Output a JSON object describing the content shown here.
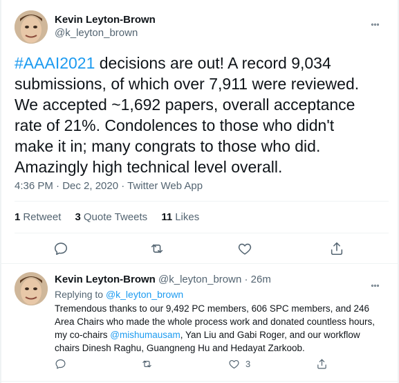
{
  "main_tweet": {
    "display_name": "Kevin Leyton-Brown",
    "handle": "@k_leyton_brown",
    "text_hashtag": "#AAAI2021",
    "text_body": " decisions are out! A record 9,034 submissions, of which over 7,911 were reviewed.  We accepted ~1,692 papers, overall acceptance rate of 21%. Condolences to those who didn't make it in; many congrats to those who did. Amazingly high technical level overall.",
    "timestamp": "4:36 PM · Dec 2, 2020 · Twitter Web App",
    "stats": {
      "retweets_count": "1",
      "retweets_label": "Retweet",
      "quote_count": "3",
      "quote_label": "Quote Tweets",
      "likes_count": "11",
      "likes_label": "Likes"
    }
  },
  "reply_tweet": {
    "display_name": "Kevin Leyton-Brown",
    "handle": "@k_leyton_brown",
    "time": "· 26m",
    "replying_prefix": "Replying to ",
    "replying_to": "@k_leyton_brown",
    "text_part1": "Tremendous thanks to our 9,492 PC members, 606 SPC members, and 246 Area Chairs who made the whole process work and donated countless hours, my co-chairs ",
    "text_mention": "@mishumausam",
    "text_part2": ", Yan Liu and Gabi Roger, and our workflow chairs Dinesh Raghu, Guangneng Hu and Hedayat Zarkoob.",
    "like_count": "3"
  },
  "icons": [
    "more-icon",
    "reply-icon",
    "retweet-icon",
    "like-icon",
    "share-icon"
  ],
  "colors": {
    "accent": "#1d9bf0",
    "text": "#0f1419",
    "secondary": "#536471",
    "divider": "#eff3f4"
  }
}
